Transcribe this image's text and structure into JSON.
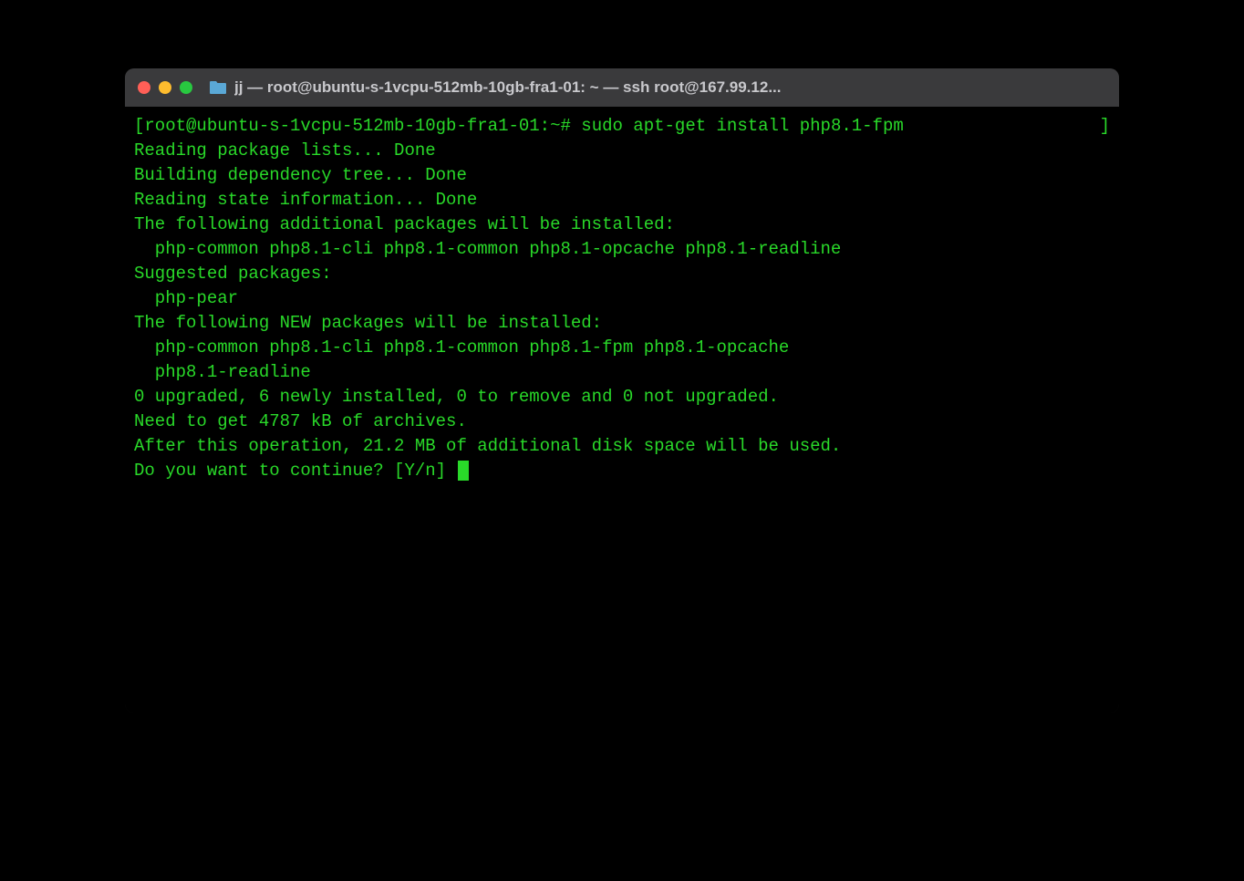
{
  "window": {
    "title": "jj — root@ubuntu-s-1vcpu-512mb-10gb-fra1-01: ~ — ssh root@167.99.12..."
  },
  "prompt": {
    "open_bracket": "[",
    "label": "root@ubuntu-s-1vcpu-512mb-10gb-fra1-01:~#",
    "command": "sudo apt-get install php8.1-fpm",
    "close_bracket": "]"
  },
  "output": {
    "l1": "Reading package lists... Done",
    "l2": "Building dependency tree... Done",
    "l3": "Reading state information... Done",
    "l4": "The following additional packages will be installed:",
    "l5": "  php-common php8.1-cli php8.1-common php8.1-opcache php8.1-readline",
    "l6": "Suggested packages:",
    "l7": "  php-pear",
    "l8": "The following NEW packages will be installed:",
    "l9": "  php-common php8.1-cli php8.1-common php8.1-fpm php8.1-opcache",
    "l10": "  php8.1-readline",
    "l11": "0 upgraded, 6 newly installed, 0 to remove and 0 not upgraded.",
    "l12": "Need to get 4787 kB of archives.",
    "l13": "After this operation, 21.2 MB of additional disk space will be used.",
    "l14": "Do you want to continue? [Y/n] "
  }
}
